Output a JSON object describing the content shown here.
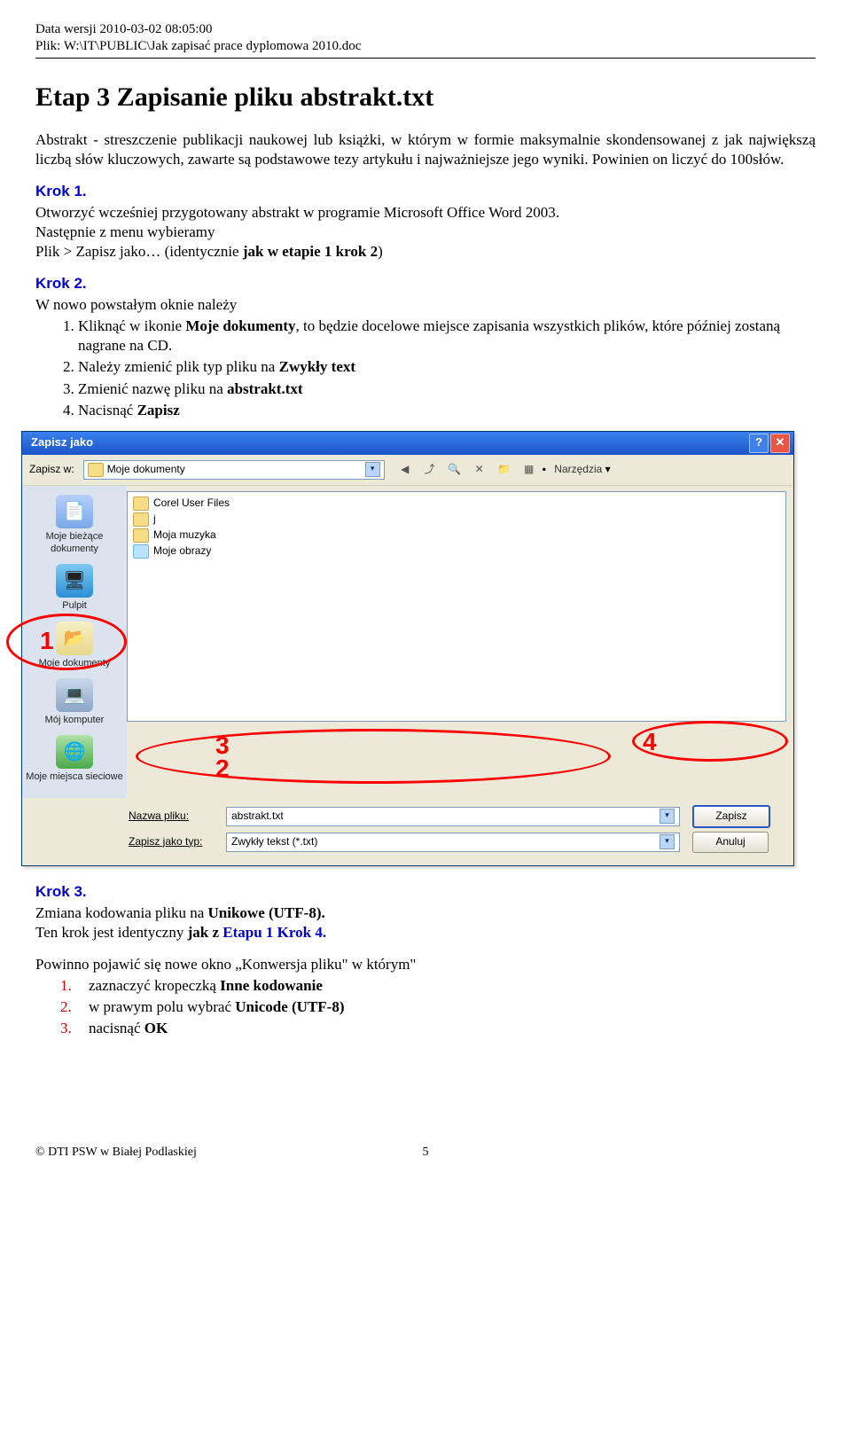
{
  "header": {
    "line1": "Data wersji 2010-03-02 08:05:00",
    "line2": "Plik: W:\\IT\\PUBLIC\\Jak zapisać prace dyplomowa 2010.doc"
  },
  "title": "Etap 3 Zapisanie pliku abstrakt.txt",
  "intro": "Abstrakt - streszczenie publikacji naukowej lub książki, w którym w formie maksymalnie skondensowanej z jak największą liczbą słów kluczowych, zawarte są podstawowe tezy artykułu i najważniejsze jego wyniki. Powinien on liczyć do 100słów.",
  "krok1": {
    "heading": "Krok 1.",
    "p1": "Otworzyć wcześniej przygotowany abstrakt w programie Microsoft Office Word 2003.",
    "p2_a": "Następnie z menu wybieramy",
    "p2_b": "Plik > Zapisz jako… (identycznie ",
    "p2_b_bold": "jak w etapie 1 krok 2",
    "p2_b_tail": ")"
  },
  "krok2": {
    "heading": "Krok 2.",
    "lead": "W nowo powstałym oknie należy",
    "items": [
      {
        "pre": "Kliknąć w ikonie ",
        "b": "Moje dokumenty",
        "post": ", to będzie docelowe miejsce zapisania wszystkich plików, które później zostaną nagrane na CD."
      },
      {
        "pre": "Należy zmienić plik typ pliku na ",
        "b": "Zwykły text",
        "post": ""
      },
      {
        "pre": "Zmienić nazwę pliku na ",
        "b": "abstrakt.txt",
        "post": ""
      },
      {
        "pre": "Nacisnąć ",
        "b": "Zapisz",
        "post": ""
      }
    ]
  },
  "dialog": {
    "title": "Zapisz jako",
    "save_in_label": "Zapisz w:",
    "save_in_value": "Moje dokumenty",
    "tools_label": "Narzędzia",
    "sidebar": [
      "Moje bieżące dokumenty",
      "Pulpit",
      "Moje dokumenty",
      "Mój komputer",
      "Moje miejsca sieciowe"
    ],
    "files": [
      "Corel User Files",
      "j",
      "Moja muzyka",
      "Moje obrazy"
    ],
    "filename_label": "Nazwa pliku:",
    "filename_value": "abstrakt.txt",
    "filetype_label": "Zapisz jako typ:",
    "filetype_value": "Zwykły tekst (*.txt)",
    "save_btn": "Zapisz",
    "cancel_btn": "Anuluj",
    "annotations": {
      "a1": "1",
      "a2": "2",
      "a3": "3",
      "a4": "4"
    }
  },
  "krok3": {
    "heading": "Krok 3.",
    "p1_a": "Zmiana kodowania pliku na ",
    "p1_b": "Unikowe (UTF-8).",
    "p2_a": "Ten krok jest identyczny ",
    "p2_b": "jak z ",
    "p2_link": "Etapu 1 Krok 4.",
    "p3": "Powinno pojawić się nowe okno „Konwersja pliku\" w którym\"",
    "items": [
      {
        "pre": "zaznaczyć kropeczką ",
        "b": "Inne kodowanie",
        "post": ""
      },
      {
        "pre": "w prawym polu wybrać ",
        "b": "Unicode (UTF-8)",
        "post": ""
      },
      {
        "pre": "nacisnąć ",
        "b": "OK",
        "post": ""
      }
    ]
  },
  "footer": {
    "copyright": "© DTI PSW w Białej Podlaskiej",
    "page_number": "5"
  }
}
